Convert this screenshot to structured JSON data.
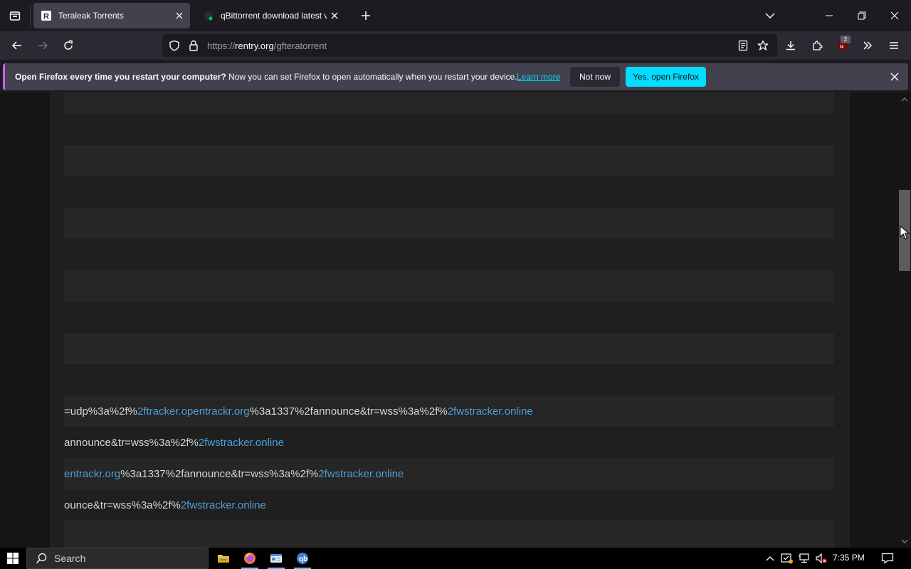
{
  "tabs": [
    {
      "title": "Teraleak Torrents",
      "active": true
    },
    {
      "title": "qBittorrent download latest ver",
      "active": false
    }
  ],
  "url": {
    "scheme": "https://",
    "host": "rentry.org",
    "path": "/gfteratorrent"
  },
  "toolbar": {
    "extensions_badge": "2"
  },
  "notification": {
    "bold": "Open Firefox every time you restart your computer?",
    "text": "Now you can set Firefox to open automatically when you restart your device.",
    "link": "Learn more",
    "not_now": "Not now",
    "yes": "Yes, open Firefox"
  },
  "code_lines": [
    {
      "pre": "=udp%3a%2f%",
      "link1": "2ftracker.opentrackr.org",
      "mid": "%3a1337%2fannounce&tr=wss%3a%2f%",
      "link2": "2fwstracker.online"
    },
    {
      "pre": "announce&tr=wss%3a%2f%",
      "link1": "2fwstracker.online",
      "mid": "",
      "link2": ""
    },
    {
      "pre": "",
      "link1": "entrackr.org",
      "mid": "%3a1337%2fannounce&tr=wss%3a%2f%",
      "link2": "2fwstracker.online"
    },
    {
      "pre": "ounce&tr=wss%3a%2f%",
      "link1": "2fwstracker.online",
      "mid": "",
      "link2": ""
    }
  ],
  "taskbar": {
    "search_label": "Search",
    "clock": "7:35 PM"
  },
  "colors": {
    "accent": "#00ddff",
    "link": "#4e9fd8",
    "notify_border": "#c265f7"
  }
}
